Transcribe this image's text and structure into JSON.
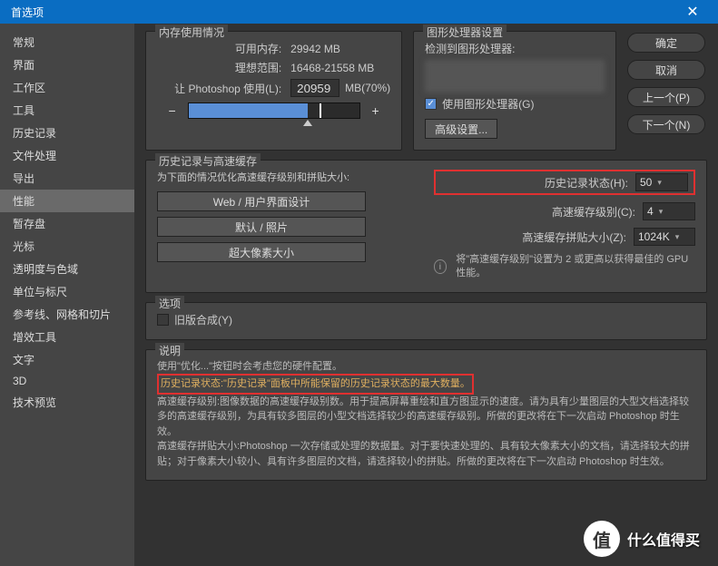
{
  "title": "首选项",
  "buttons": {
    "ok": "确定",
    "cancel": "取消",
    "prev": "上一个(P)",
    "next": "下一个(N)"
  },
  "sidebar": {
    "items": [
      "常规",
      "界面",
      "工作区",
      "工具",
      "历史记录",
      "文件处理",
      "导出",
      "性能",
      "暂存盘",
      "光标",
      "透明度与色域",
      "单位与标尺",
      "参考线、网格和切片",
      "增效工具",
      "文字",
      "3D",
      "技术预览"
    ],
    "active_index": 7
  },
  "memory": {
    "title": "内存使用情况",
    "available_label": "可用内存:",
    "available_value": "29942 MB",
    "ideal_label": "理想范围:",
    "ideal_value": "16468-21558 MB",
    "use_label": "让 Photoshop 使用(L):",
    "use_value": "20959",
    "use_suffix": "MB(70%)"
  },
  "gpu": {
    "title": "图形处理器设置",
    "detected_label": "检测到图形处理器:",
    "use_gpu": "使用图形处理器(G)",
    "advanced": "高级设置..."
  },
  "history": {
    "title": "历史记录与高速缓存",
    "subtitle": "为下面的情况优化高速缓存级别和拼贴大小:",
    "btn_web": "Web / 用户界面设计",
    "btn_default": "默认 / 照片",
    "btn_large": "超大像素大小",
    "states_label": "历史记录状态(H):",
    "states_value": "50",
    "cache_levels_label": "高速缓存级别(C):",
    "cache_levels_value": "4",
    "tile_label": "高速缓存拼贴大小(Z):",
    "tile_value": "1024K",
    "tip": "将\"高速缓存级别\"设置为 2 或更高以获得最佳的 GPU性能。"
  },
  "options": {
    "title": "选项",
    "legacy": "旧版合成(Y)"
  },
  "description": {
    "title": "说明",
    "line1": "使用\"优化...\"按钮时会考虑您的硬件配置。",
    "highlight": "历史记录状态:\"历史记录\"面板中所能保留的历史记录状态的最大数量。",
    "body": "高速缓存级别:图像数据的高速缓存级别数。用于提高屏幕重绘和直方图显示的速度。请为具有少量图层的大型文档选择较多的高速缓存级别，为具有较多图层的小型文档选择较少的高速缓存级别。所做的更改将在下一次启动 Photoshop 时生效。\n高速缓存拼贴大小:Photoshop 一次存储或处理的数据量。对于要快速处理的、具有较大像素大小的文档，请选择较大的拼贴；对于像素大小较小、具有许多图层的文档，请选择较小的拼贴。所做的更改将在下一次启动 Photoshop 时生效。"
  },
  "watermark": {
    "icon": "值",
    "text": "什么值得买"
  }
}
